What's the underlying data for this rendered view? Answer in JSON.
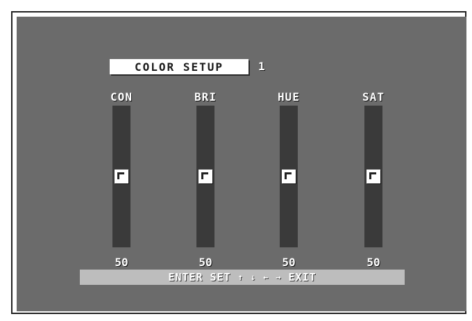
{
  "menu": {
    "title": "COLOR SETUP",
    "page": "1"
  },
  "sliders": [
    {
      "label": "CON",
      "value": "50",
      "level": 0.5
    },
    {
      "label": "BRI",
      "value": "50",
      "level": 0.5
    },
    {
      "label": "HUE",
      "value": "50",
      "level": 0.5
    },
    {
      "label": "SAT",
      "value": "50",
      "level": 0.5
    }
  ],
  "footer": {
    "enter": "ENTER",
    "set": "SET",
    "arrow_up": "↑",
    "arrow_down": "↓",
    "arrow_left": "←",
    "arrow_right": "→",
    "exit": "EXIT"
  },
  "colors": {
    "background": "#6b6b6b",
    "track": "#3a3a3a",
    "footer_bar": "#bdbdbd"
  }
}
